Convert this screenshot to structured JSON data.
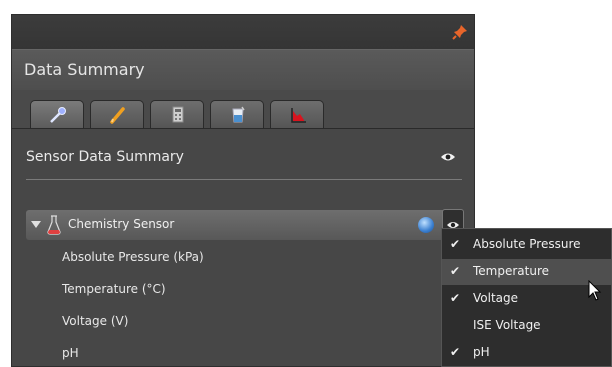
{
  "panel": {
    "title": "Data Summary",
    "tabs": [
      {
        "icon": "wand-icon",
        "active": true
      },
      {
        "icon": "pencil-icon",
        "active": false
      },
      {
        "icon": "calculator-icon",
        "active": false
      },
      {
        "icon": "beaker-icon",
        "active": false
      },
      {
        "icon": "chart-icon",
        "active": false
      }
    ],
    "section_title": "Sensor Data Summary",
    "sensor": {
      "name": "Chemistry Sensor",
      "rows": [
        "Absolute Pressure (kPa)",
        "Temperature (°C)",
        "Voltage (V)",
        "pH"
      ]
    }
  },
  "menu": {
    "items": [
      {
        "label": "Absolute Pressure",
        "checked": true,
        "highlighted": false
      },
      {
        "label": "Temperature",
        "checked": true,
        "highlighted": true
      },
      {
        "label": "Voltage",
        "checked": true,
        "highlighted": false
      },
      {
        "label": "ISE Voltage",
        "checked": false,
        "highlighted": false
      },
      {
        "label": "pH",
        "checked": true,
        "highlighted": false
      }
    ]
  },
  "colors": {
    "pin": "#e8652a",
    "pencil": "#f0a020",
    "chart_red": "#d8141e",
    "globe": "#3a7fd0"
  }
}
